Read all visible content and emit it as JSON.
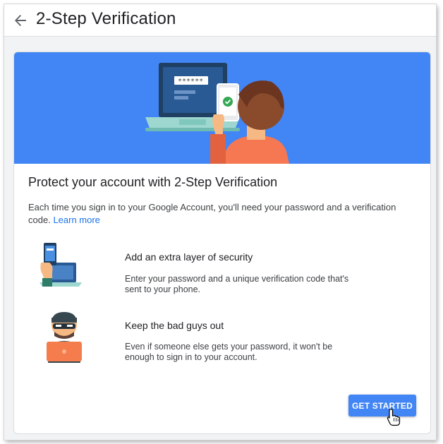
{
  "header": {
    "title": "2-Step Verification"
  },
  "hero": {
    "password_mask": "******"
  },
  "main": {
    "heading": "Protect your account with 2-Step Verification",
    "description": "Each time you sign in to your Google Account, you'll need your password and a verification code.",
    "learn_more": "Learn more",
    "features": [
      {
        "title": "Add an extra layer of security",
        "body": "Enter your password and a unique verification code that's sent to your phone.",
        "icon": "phone-laptop-icon"
      },
      {
        "title": "Keep the bad guys out",
        "body": "Even if someone else gets your password, it won't be enough to sign in to your account.",
        "icon": "burglar-icon"
      }
    ],
    "cta": "GET STARTED"
  },
  "colors": {
    "brand_blue": "#4285f4",
    "link_blue": "#1a73e8",
    "text": "#202124"
  }
}
